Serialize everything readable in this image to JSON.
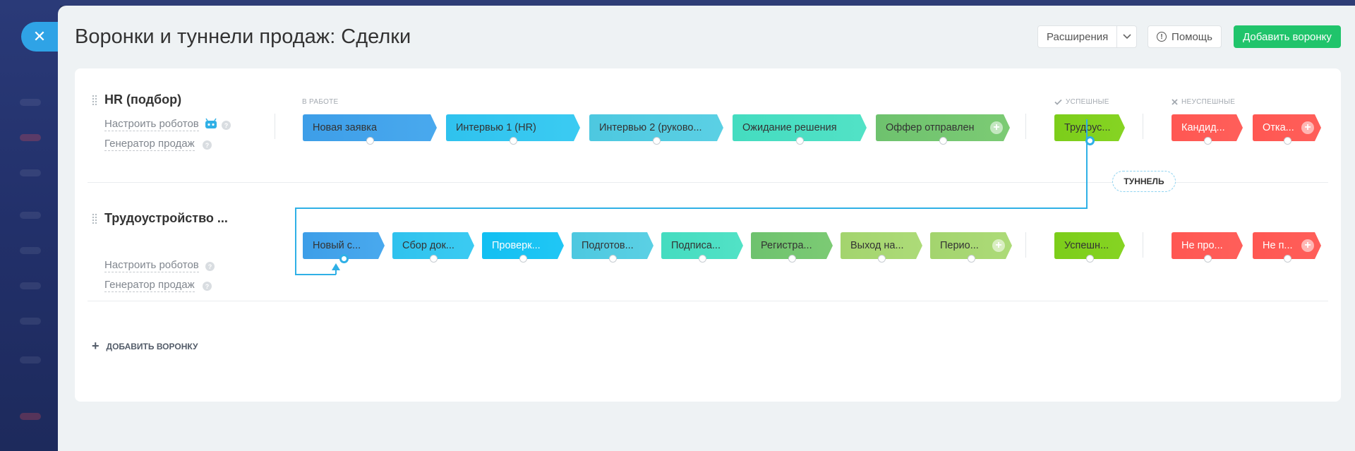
{
  "page": {
    "title": "Воронки и туннели продаж: Сделки"
  },
  "header": {
    "extensions_label": "Расширения",
    "help_label": "Помощь",
    "add_funnel_label": "Добавить воронку"
  },
  "columns": {
    "in_progress": "В РАБОТЕ",
    "success": "УСПЕШНЫЕ",
    "fail": "НЕУСПЕШНЫЕ"
  },
  "funnels": [
    {
      "name": "HR (подбор)",
      "robots_link": "Настроить роботов",
      "generator_link": "Генератор продаж",
      "stages": [
        "Новая заявка",
        "Интервью 1 (HR)",
        "Интервью 2 (руково...",
        "Ожидание решения",
        "Оффер отправлен"
      ],
      "success": "Трудоус...",
      "fail": [
        "Кандид...",
        "Отка..."
      ]
    },
    {
      "name": "Трудоустройство ...",
      "robots_link": "Настроить роботов",
      "generator_link": "Генератор продаж",
      "stages": [
        "Новый с...",
        "Сбор док...",
        "Проверк...",
        "Подготов...",
        "Подписа...",
        "Регистра...",
        "Выход на...",
        "Перио..."
      ],
      "success": "Успешн...",
      "fail": [
        "Не про...",
        "Не п..."
      ]
    }
  ],
  "tunnel_label": "ТУННЕЛЬ",
  "add_funnel_row": "ДОБАВИТЬ ВОРОНКУ",
  "colors": {
    "accent": "#2fb0e6",
    "add_button": "#20c46b",
    "success_stage": "#7ccd1a",
    "fail_stage": "#ff5752"
  },
  "icons": {
    "close": "close-icon",
    "help": "help-icon",
    "robot": "robot-icon",
    "chevron": "chevron-down-icon",
    "plus": "plus-icon"
  }
}
